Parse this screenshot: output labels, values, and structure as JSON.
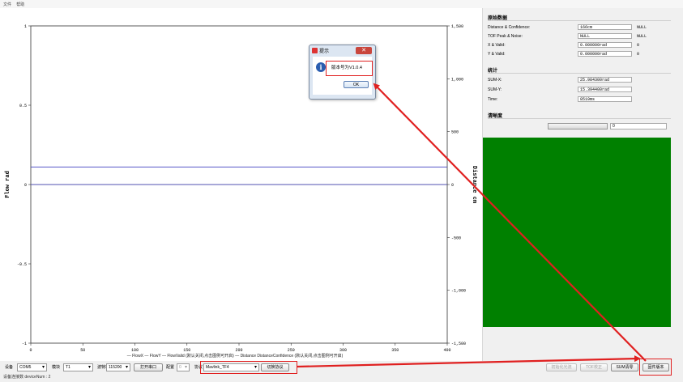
{
  "menu": [
    "文件",
    "帮助"
  ],
  "panel": {
    "sections": {
      "raw": "原始数据",
      "stats": "统计",
      "clarity": "清晰度"
    },
    "raw_rows": [
      {
        "label": "Distance & Confidence:",
        "value": "166cm",
        "extra": "NULL"
      },
      {
        "label": "TOF Peak & Noise:",
        "value": "NULL",
        "extra": "NULL"
      },
      {
        "label": "X & Valid:",
        "value": "0.000000rad",
        "extra": "0"
      },
      {
        "label": "Y & Valid:",
        "value": "0.000000rad",
        "extra": "0"
      }
    ],
    "stats_rows": [
      {
        "label": "SUM-X:",
        "value": "25.984300rad"
      },
      {
        "label": "SUM-Y:",
        "value": "15.394400rad"
      },
      {
        "label": "Time:",
        "value": "8519ms"
      }
    ],
    "clarity_value": "0",
    "clarity_fraction": 1.0,
    "image_color": "#008000"
  },
  "toolbar": {
    "device_label": "设备",
    "device_value": "COM5",
    "module_label": "模块",
    "module_value": "T1",
    "baud_label": "波特率",
    "baud_value": "115200",
    "open_port": "打开串口",
    "config_label": "配置",
    "config_value": "0",
    "protocol_label": "协议",
    "protocol_value": "Mavlink_TF4",
    "switch_protocol": "切换协议",
    "init_optical": "初始化光流",
    "tof_calib": "TOF校正",
    "sum_clear": "SUM清零",
    "firmware_version": "固件版本"
  },
  "status": "设备连接数 deviceNum : 2",
  "dialog": {
    "title": "提示",
    "message": "版本号为V1.0.4",
    "ok": "OK"
  },
  "chart_data": {
    "type": "line",
    "xlabel": "",
    "ylabel": "Flow rad",
    "y2label": "Distance cm",
    "xlim": [
      0,
      400
    ],
    "ylim": [
      -1,
      1
    ],
    "y2lim": [
      -1500,
      1500
    ],
    "xticks": [
      "0",
      "50",
      "100",
      "150",
      "200",
      "250",
      "300",
      "350",
      "400"
    ],
    "yticks": [
      "-1",
      "-0.5",
      "0",
      "0.5",
      "1"
    ],
    "y2ticks": [
      "-1,500",
      "-1,000",
      "-500",
      "0",
      "500",
      "1,000",
      "1,500"
    ],
    "legend_text": "— FlowX — FlowY — FlowValid (默认关闭,点击图例可开启) — Distance DistanceConfidence (默认关闭,点击图例可开启)",
    "series": [
      {
        "name": "FlowX",
        "color": "#c02020",
        "values": [
          {
            "x": 0,
            "y": 0
          },
          {
            "x": 400,
            "y": 0
          }
        ]
      },
      {
        "name": "FlowY",
        "color": "#5050b0",
        "values": [
          {
            "x": 0,
            "y": 0
          },
          {
            "x": 400,
            "y": 0
          }
        ]
      },
      {
        "name": "Distance",
        "color": "#4040c0",
        "axis": "right",
        "values": [
          {
            "x": 0,
            "y": 166
          },
          {
            "x": 400,
            "y": 166
          }
        ]
      }
    ]
  }
}
